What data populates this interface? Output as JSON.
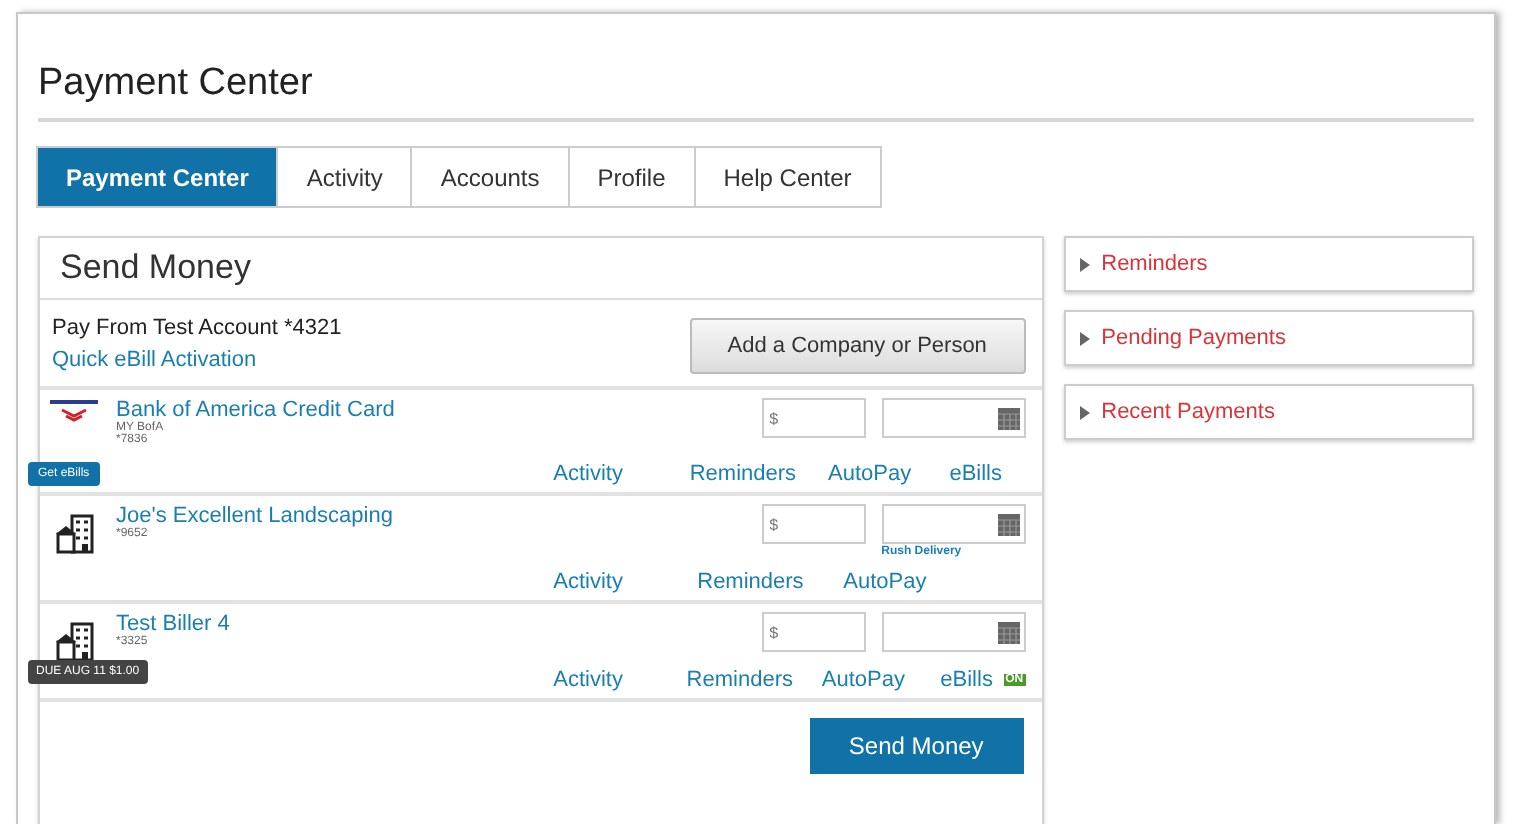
{
  "page_title": "Payment Center",
  "tabs": [
    {
      "label": "Payment Center",
      "selected": true
    },
    {
      "label": "Activity",
      "selected": false
    },
    {
      "label": "Accounts",
      "selected": false
    },
    {
      "label": "Profile",
      "selected": false
    },
    {
      "label": "Help Center",
      "selected": false
    }
  ],
  "send_money": {
    "title": "Send Money",
    "pay_from": "Pay From Test Account *4321",
    "quick_link": "Quick eBill Activation",
    "add_button": "Add a Company or Person",
    "billers": [
      {
        "kind": "bank",
        "name": "Bank of America Credit Card",
        "details": [
          "MY BofA",
          "*7836"
        ],
        "amount_placeholder": "$",
        "links": [
          "Activity",
          "Reminders",
          "AutoPay",
          "eBills"
        ],
        "badge": {
          "kind": "button",
          "text": "Get eBills"
        }
      },
      {
        "kind": "building",
        "name": "Joe's Excellent Landscaping",
        "details": [
          "*9652"
        ],
        "amount_placeholder": "$",
        "rush": "Rush Delivery",
        "links": [
          "Activity",
          "Reminders",
          "AutoPay"
        ]
      },
      {
        "kind": "building",
        "name": "Test Biller 4",
        "details": [
          "*3325"
        ],
        "amount_placeholder": "$",
        "links": [
          "Activity",
          "Reminders",
          "AutoPay",
          "eBills"
        ],
        "ebills_tag": "ON",
        "badge": {
          "kind": "tooltip",
          "text": "DUE AUG 11 $1.00"
        }
      }
    ],
    "submit": "Send Money"
  },
  "side_panels": [
    {
      "label": "Reminders",
      "expanded": false
    },
    {
      "label": "Pending Payments",
      "expanded": false
    },
    {
      "label": "Recent Payments",
      "expanded": false
    }
  ]
}
